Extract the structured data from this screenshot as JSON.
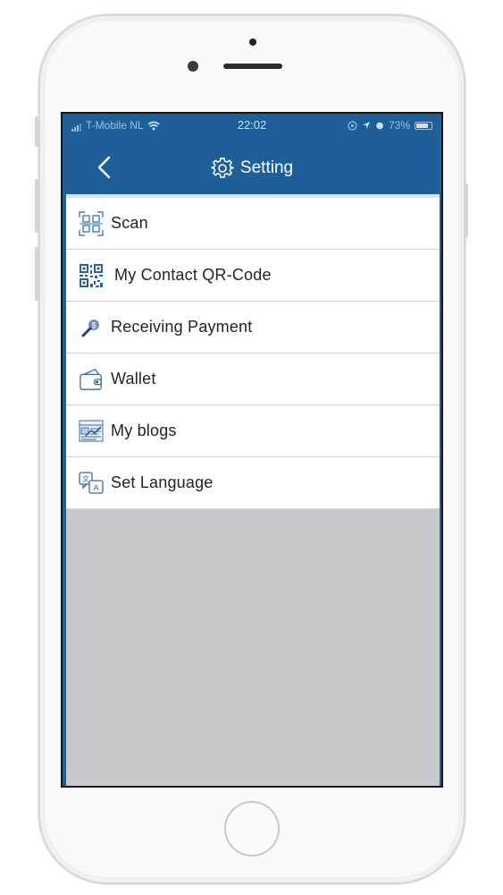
{
  "status_bar": {
    "carrier": "T-Mobile NL",
    "time": "22:02",
    "battery": "73%"
  },
  "header": {
    "title": "Setting",
    "back_icon": "chevron-left-icon",
    "title_icon": "gear-icon"
  },
  "menu": {
    "items": [
      {
        "label": "Scan",
        "icon": "scan-icon"
      },
      {
        "label": "My Contact QR-Code",
        "icon": "qr-code-icon"
      },
      {
        "label": "Receiving Payment",
        "icon": "payment-icon"
      },
      {
        "label": "Wallet",
        "icon": "wallet-icon"
      },
      {
        "label": "My blogs",
        "icon": "blog-icon"
      },
      {
        "label": "Set Language",
        "icon": "language-icon"
      }
    ]
  },
  "colors": {
    "navbar": "#1e5f99",
    "accent": "#2f6aa8",
    "background": "#c9c8cc"
  }
}
